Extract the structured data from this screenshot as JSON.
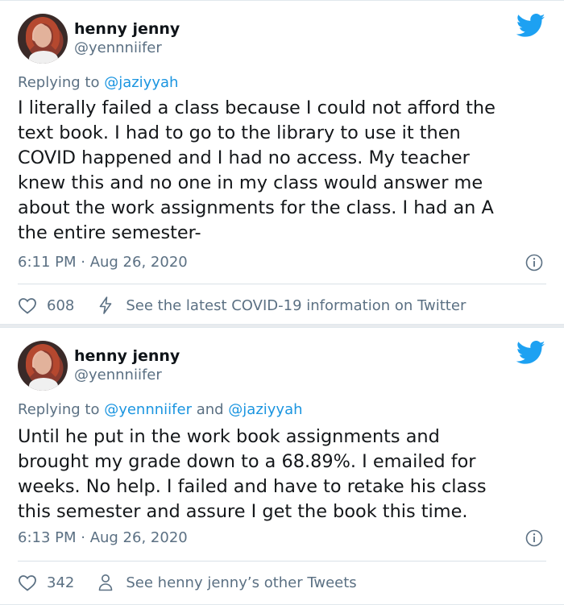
{
  "tweets": [
    {
      "author_name": "henny jenny",
      "author_handle": "@yennniifer",
      "reply_prefix": "Replying to ",
      "reply_to": "@jaziyyah",
      "reply_joiner": "",
      "reply_to_2": "",
      "text": "I literally failed a class because I could not afford the\ntext book. I had to go to the library to use it then\nCOVID happened and I had no access. My teacher\nknew this and no one in my class would answer me\nabout the work assignments for the class. I had an A\nthe entire semester-",
      "timestamp": "6:11 PM · Aug 26, 2020",
      "likes": "608",
      "action_text": "See the latest COVID-19 information on Twitter"
    },
    {
      "author_name": "henny jenny",
      "author_handle": "@yennniifer",
      "reply_prefix": "Replying to ",
      "reply_to": "@yennniifer",
      "reply_joiner": " and ",
      "reply_to_2": "@jaziyyah",
      "text": "Until he put in the work book assignments and\nbrought my grade down to a 68.89%. I emailed for\nweeks. No help. I failed and have to retake his class\nthis semester and assure I get the book this time.",
      "timestamp": "6:13 PM · Aug 26, 2020",
      "likes": "342",
      "action_text": "See henny jenny’s other Tweets"
    }
  ],
  "colors": {
    "twitter_blue": "#1da1f2",
    "link_blue": "#1b95e0",
    "muted": "#5b7083"
  }
}
